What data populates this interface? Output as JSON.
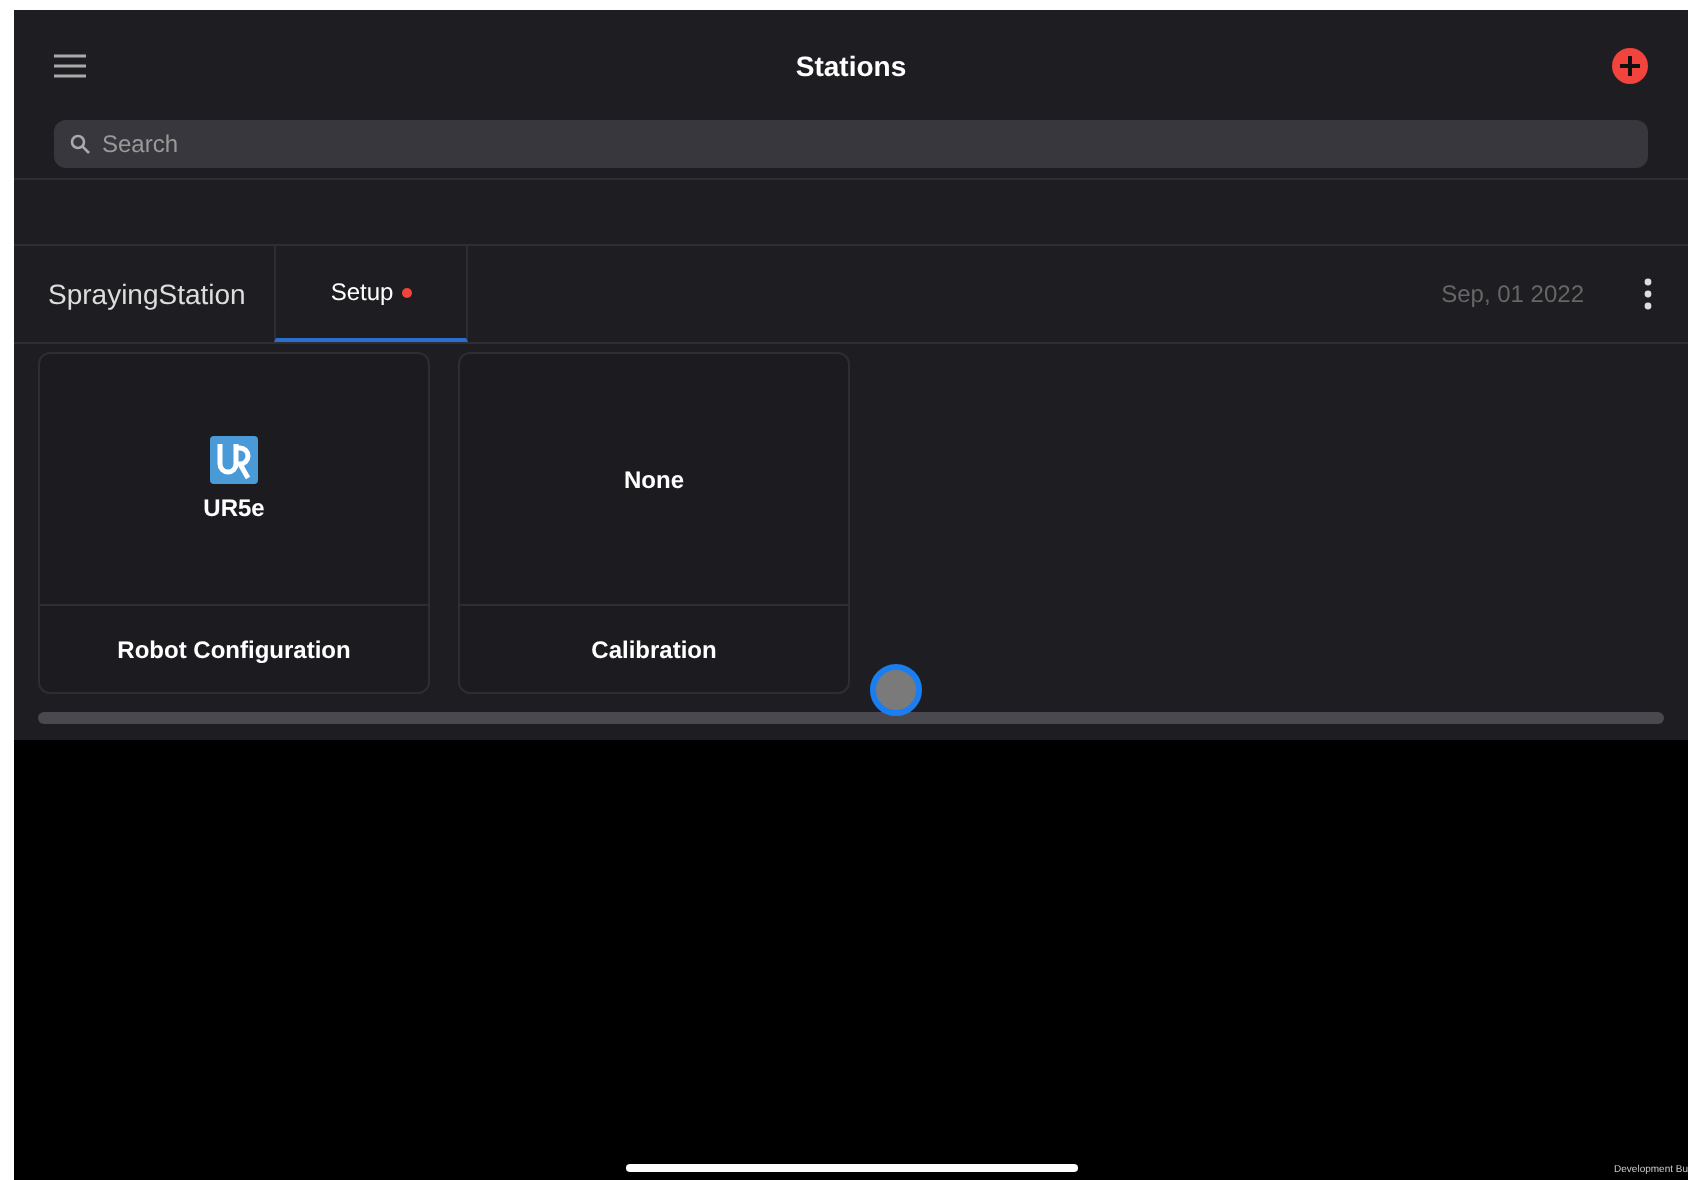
{
  "header": {
    "title": "Stations"
  },
  "search": {
    "placeholder": "Search"
  },
  "station": {
    "name": "SprayingStation",
    "date": "Sep, 01 2022"
  },
  "tabs": [
    {
      "label": "Setup",
      "selected": true,
      "alert": true
    }
  ],
  "cards": [
    {
      "kind": "logo",
      "value": "UR5e",
      "label": "Robot Configuration"
    },
    {
      "kind": "text",
      "value": "None",
      "label": "Calibration"
    }
  ],
  "footer_note": "Development Bu"
}
